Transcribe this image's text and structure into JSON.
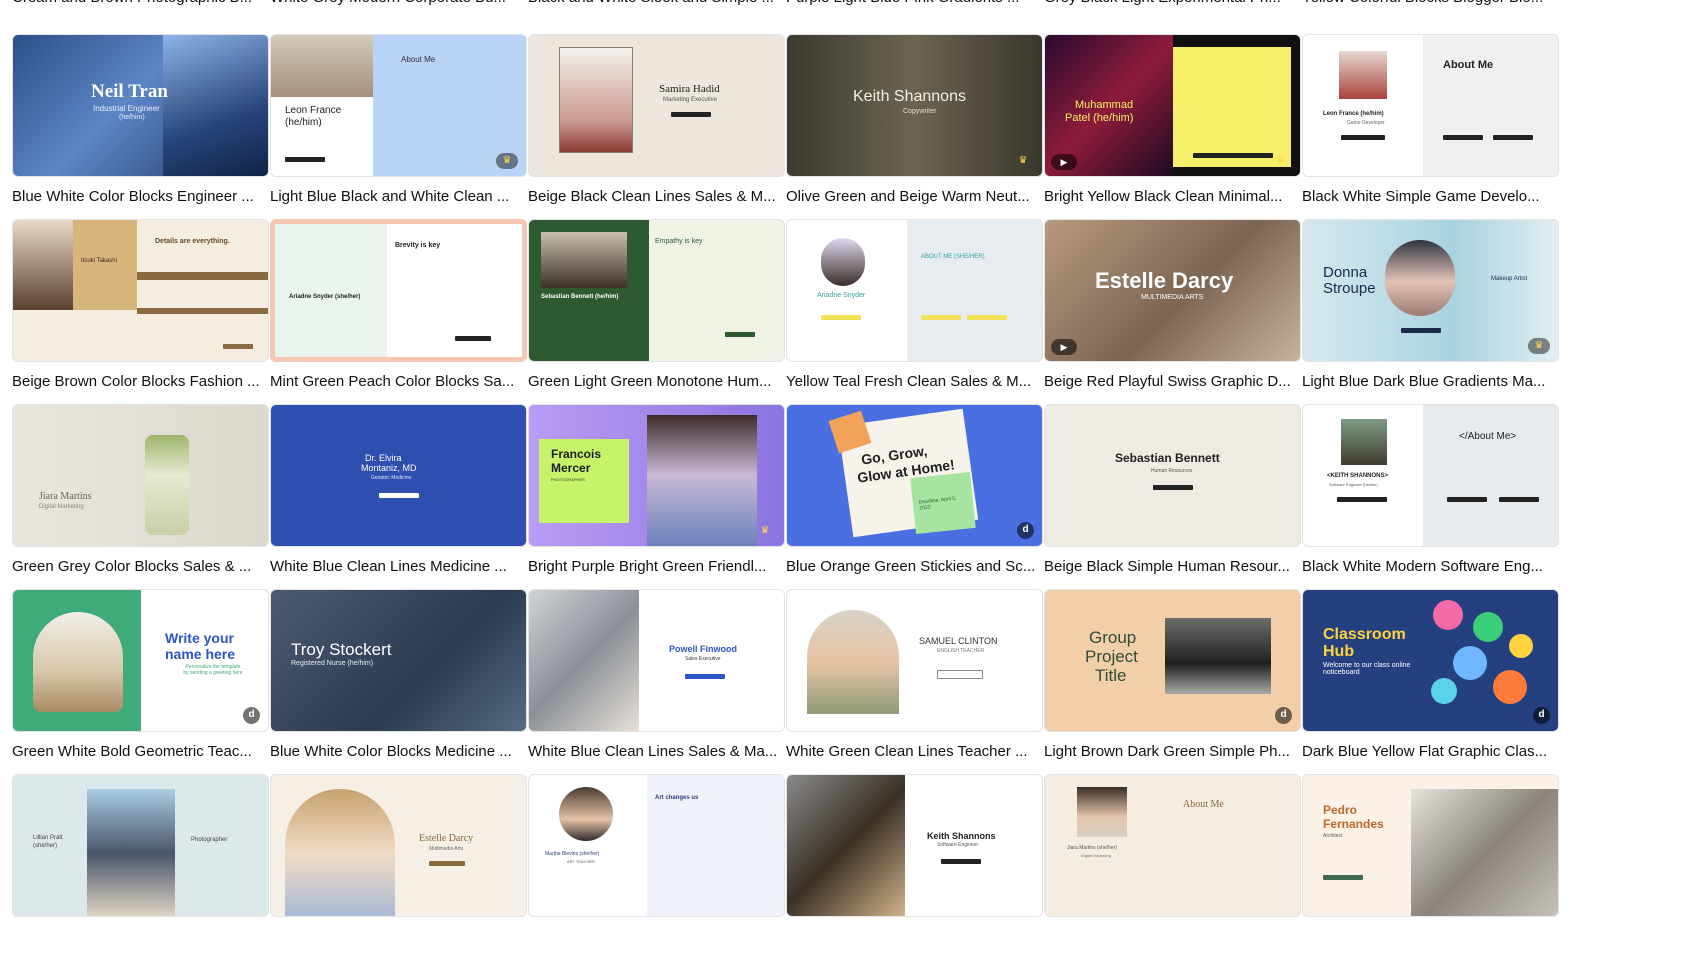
{
  "top_labels": [
    "Cream and Brown Photographic B...",
    "White Grey Modern Corporate Bu...",
    "Black and White Sleek and Simple ...",
    "Purple Light Blue Pink Gradients ...",
    "Grey Black Light Experimental Ph...",
    "Yellow Colorful Blocks Blogger Blo..."
  ],
  "rows": [
    [
      {
        "label": "Blue White Color Blocks Engineer ...",
        "text1": "Neil Tran",
        "text2": "Industrial Engineer",
        "text3": "(he/him)"
      },
      {
        "label": "Light Blue Black and White Clean ...",
        "text1": "About Me",
        "text2": "Leon France",
        "text3": "(he/him)"
      },
      {
        "label": "Beige Black Clean Lines Sales & M...",
        "text1": "Samira Hadid",
        "text2": "Marketing Executive"
      },
      {
        "label": "Olive Green and Beige Warm Neut...",
        "text1": "Keith Shannons",
        "text2": "Copywriter"
      },
      {
        "label": "Bright Yellow Black Clean Minimal...",
        "text1": "Muhammad",
        "text2": "Patel (he/him)"
      },
      {
        "label": "Black White Simple Game Develo...",
        "text1": "About Me",
        "text2": "Leon France (he/him)",
        "text3": "Game Developer"
      }
    ],
    [
      {
        "label": "Beige Brown Color Blocks Fashion ...",
        "text1": "Details are everything.",
        "text2": "Itsuki Takashi"
      },
      {
        "label": "Mint Green Peach Color Blocks Sa...",
        "text1": "Brevity is key",
        "text2": "Ariadne Snyder (she/her)"
      },
      {
        "label": "Green Light Green Monotone Hum...",
        "text1": "Empathy is key",
        "text2": "Sebastian Bennett (he/him)"
      },
      {
        "label": "Yellow Teal Fresh Clean Sales & M...",
        "text1": "ABOUT ME (SHE/HER)",
        "text2": "Ariadne Snyder"
      },
      {
        "label": "Beige Red Playful Swiss Graphic D...",
        "text1": "Estelle Darcy",
        "text2": "MULTIMEDIA ARTS"
      },
      {
        "label": "Light Blue Dark Blue Gradients Ma...",
        "text1": "Donna",
        "text2": "Stroupe",
        "text3": "Makeup Artist"
      }
    ],
    [
      {
        "label": "Green Grey Color Blocks Sales & ...",
        "text1": "Jiara Martins",
        "text2": "Digital Marketing"
      },
      {
        "label": "White Blue Clean Lines Medicine ...",
        "text1": "Dr. Elvira",
        "text2": "Montaniz, MD",
        "text3": "Geriatric Medicine"
      },
      {
        "label": "Bright Purple Bright Green Friendl...",
        "text1": "Francois",
        "text2": "Mercer",
        "text3": "PHOTOGRAPHER"
      },
      {
        "label": "Blue Orange Green Stickies and Sc...",
        "text1": "Go, Grow,",
        "text2": "Glow at Home!",
        "text3": "Deadline: April 5, 2023"
      },
      {
        "label": "Beige Black Simple Human Resour...",
        "text1": "Sebastian Bennett",
        "text2": "Human Resources"
      },
      {
        "label": "Black White Modern Software Eng...",
        "text1": "</About Me>",
        "text2": "<KEITH SHANNONS>",
        "text3": "Software Engineer (he/him)"
      }
    ],
    [
      {
        "label": "Green White Bold Geometric Teac...",
        "text1": "Write your",
        "text2": "name here",
        "text3": "Personalize the template by sending a greeting here"
      },
      {
        "label": "Blue White Color Blocks Medicine ...",
        "text1": "Troy Stockert",
        "text2": "Registered Nurse (he/him)"
      },
      {
        "label": "White Blue Clean Lines Sales & Ma...",
        "text1": "Powell Finwood",
        "text2": "Sales Executive"
      },
      {
        "label": "White Green Clean Lines Teacher ...",
        "text1": "SAMUEL CLINTON",
        "text2": "ENGLISH TEACHER"
      },
      {
        "label": "Light Brown Dark Green Simple Ph...",
        "text1": "Group",
        "text2": "Project",
        "text3": "Title"
      },
      {
        "label": "Dark Blue Yellow Flat Graphic Clas...",
        "text1": "Classroom",
        "text2": "Hub",
        "text3": "Welcome to our class online noticeboard"
      }
    ],
    [
      {
        "text1": "Lillian Pratt",
        "text2": "(she/her)",
        "text3": "Photographer"
      },
      {
        "text1": "Estelle Darcy",
        "text2": "Multimedia Arts"
      },
      {
        "text1": "Art changes us",
        "text2": "Martha Blevins (she/her)",
        "text3": "ART TEACHER"
      },
      {
        "text1": "Keith Shannons",
        "text2": "Software Engineer"
      },
      {
        "text1": "About Me",
        "text2": "Jiara Martins (she/her)",
        "text3": "Digital Marketing"
      },
      {
        "text1": "Pedro",
        "text2": "Fernandes",
        "text3": "Architect"
      }
    ]
  ],
  "badges": {
    "crown": "♛",
    "play": "▶",
    "designer": "d"
  },
  "colors": {
    "label": "#111111",
    "border": "#e3e3e6",
    "premium": "#ffd54a"
  }
}
